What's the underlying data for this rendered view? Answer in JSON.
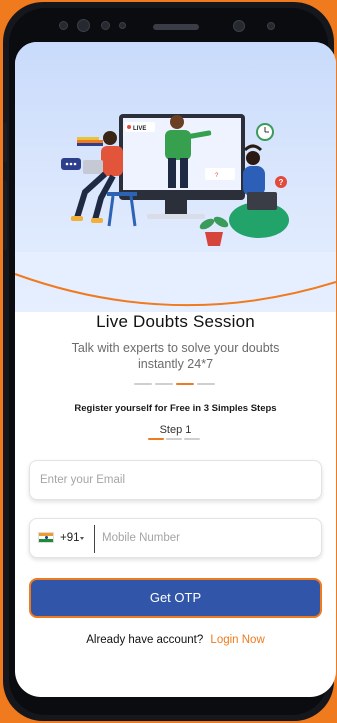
{
  "hero": {
    "live_badge": "LIVE",
    "score_badge": "?"
  },
  "title": "Live Doubts Session",
  "subtitle": "Talk with experts to solve your doubts instantly 24*7",
  "register_text": "Register yourself for Free in 3 Simples Steps",
  "step_label": "Step 1",
  "email": {
    "placeholder": "Enter your Email",
    "value": ""
  },
  "phone": {
    "country_flag": "india-flag-icon",
    "country_code": "+91",
    "placeholder": "Mobile Number",
    "value": ""
  },
  "otp_button_label": "Get OTP",
  "login": {
    "prompt": "Already have account?",
    "link_label": "Login Now"
  },
  "colors": {
    "accent": "#f07a1e",
    "primary_button": "#3155a8",
    "hero_bg": "#c9dbfb"
  }
}
